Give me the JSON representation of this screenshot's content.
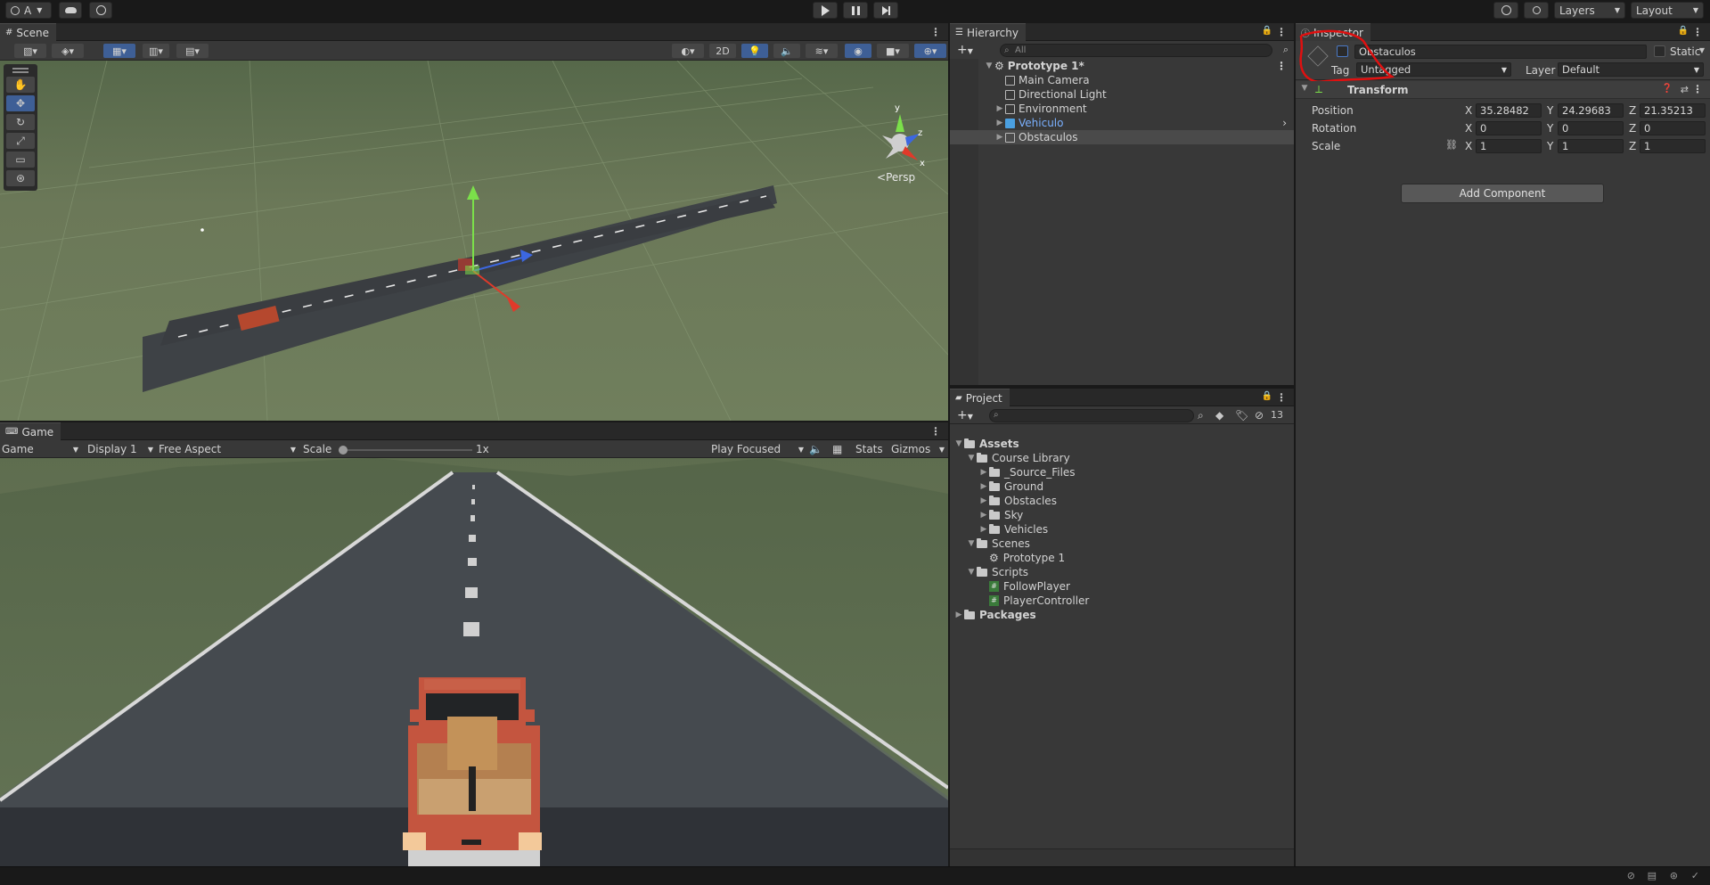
{
  "topbar": {
    "account": "A",
    "layers": "Layers",
    "layout": "Layout"
  },
  "scene": {
    "tab": "Scene",
    "btn_2d": "2D",
    "persp": "Persp"
  },
  "game": {
    "tab": "Game",
    "mode": "Game",
    "display": "Display 1",
    "aspect": "Free Aspect",
    "scale_label": "Scale",
    "scale_value": "1x",
    "play_mode": "Play Focused",
    "stats": "Stats",
    "gizmos": "Gizmos"
  },
  "hierarchy": {
    "tab": "Hierarchy",
    "search_placeholder": "All",
    "scene_name": "Prototype 1*",
    "items": [
      "Main Camera",
      "Directional Light",
      "Environment",
      "Vehiculo",
      "Obstaculos"
    ]
  },
  "project": {
    "tab": "Project",
    "hidden_count": "13",
    "tree": {
      "assets": "Assets",
      "course_library": "Course Library",
      "source_files": "_Source_Files",
      "ground": "Ground",
      "obstacles": "Obstacles",
      "sky": "Sky",
      "vehicles": "Vehicles",
      "scenes": "Scenes",
      "prototype": "Prototype 1",
      "scripts": "Scripts",
      "follow_player": "FollowPlayer",
      "player_controller": "PlayerController",
      "packages": "Packages"
    }
  },
  "inspector": {
    "tab": "Inspector",
    "object_name": "Obstaculos",
    "static_label": "Static",
    "tag_label": "Tag",
    "tag_value": "Untagged",
    "layer_label": "Layer",
    "layer_value": "Default",
    "transform_title": "Transform",
    "position_label": "Position",
    "rotation_label": "Rotation",
    "scale_label": "Scale",
    "pos_x": "35.28482",
    "pos_y": "24.29683",
    "pos_z": "21.35213",
    "rot_x": "0",
    "rot_y": "0",
    "rot_z": "0",
    "scl_x": "1",
    "scl_y": "1",
    "scl_z": "1",
    "axis_x": "X",
    "axis_y": "Y",
    "axis_z": "Z",
    "add_component": "Add Component"
  },
  "colors": {
    "accent": "#3e5f96",
    "selected_text": "#7ab0ff",
    "annotation": "#e01010"
  }
}
